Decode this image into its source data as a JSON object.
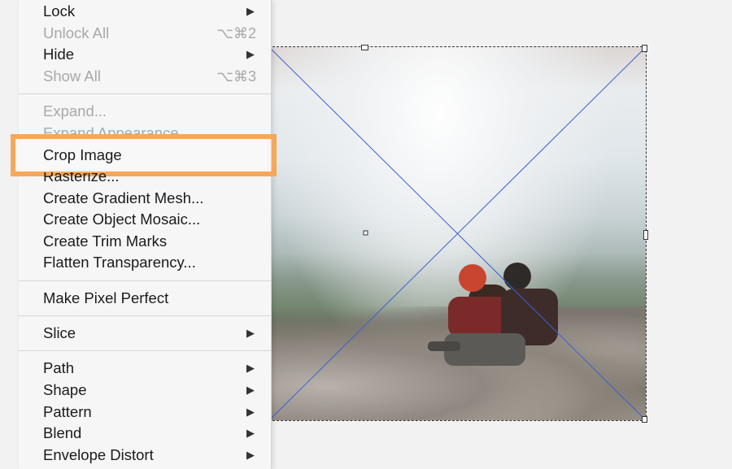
{
  "menu": {
    "items": [
      {
        "label": "Lock",
        "disabled": false,
        "submenu": true
      },
      {
        "label": "Unlock All",
        "disabled": true,
        "shortcut": "⌥⌘2"
      },
      {
        "label": "Hide",
        "disabled": false,
        "submenu": true
      },
      {
        "label": "Show All",
        "disabled": true,
        "shortcut": "⌥⌘3"
      },
      {
        "label": "Expand...",
        "disabled": true
      },
      {
        "label": "Expand Appearance",
        "disabled": true
      },
      {
        "label": "Crop Image",
        "disabled": false,
        "highlighted": true
      },
      {
        "label": "Rasterize...",
        "disabled": false
      },
      {
        "label": "Create Gradient Mesh...",
        "disabled": false
      },
      {
        "label": "Create Object Mosaic...",
        "disabled": false
      },
      {
        "label": "Create Trim Marks",
        "disabled": false
      },
      {
        "label": "Flatten Transparency...",
        "disabled": false
      },
      {
        "label": "Make Pixel Perfect",
        "disabled": false
      },
      {
        "label": "Slice",
        "disabled": false,
        "submenu": true
      },
      {
        "label": "Path",
        "disabled": false,
        "submenu": true
      },
      {
        "label": "Shape",
        "disabled": false,
        "submenu": true
      },
      {
        "label": "Pattern",
        "disabled": false,
        "submenu": true
      },
      {
        "label": "Blend",
        "disabled": false,
        "submenu": true
      },
      {
        "label": "Envelope Distort",
        "disabled": false,
        "submenu": true
      }
    ],
    "submenu_arrow": "▶"
  },
  "colors": {
    "highlight_border": "#f5a85a",
    "selection_line": "#3a5fd0",
    "disabled_text": "#a8a8a8"
  },
  "canvas": {
    "image_description_icon": "photo-icon"
  }
}
